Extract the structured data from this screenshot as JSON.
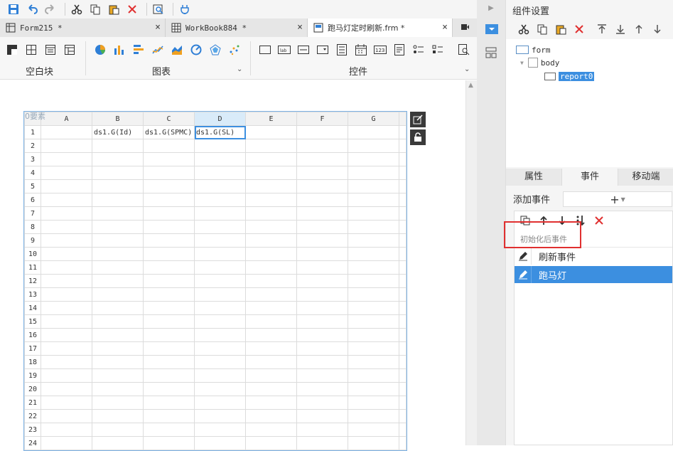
{
  "colors": {
    "accent": "#3c8fe0",
    "highlight_box": "#e03030"
  },
  "toolbar": {
    "icons": [
      "save-icon",
      "undo-icon",
      "redo-icon",
      "cut-icon",
      "copy-icon",
      "paste-icon",
      "delete-icon",
      "preview-icon",
      "plugin-icon"
    ]
  },
  "tabs": [
    {
      "label": "Form215 *",
      "icon": "form-icon"
    },
    {
      "label": "WorkBook884 *",
      "icon": "workbook-icon"
    },
    {
      "label": "跑马灯定时刷新.frm *",
      "icon": "frm-icon"
    }
  ],
  "ribbon": {
    "blank_group_label": "空白块",
    "chart_group_label": "图表",
    "widget_group_label": "控件"
  },
  "grid": {
    "corner_tag": "0要素",
    "columns": [
      "A",
      "B",
      "C",
      "D",
      "E",
      "F",
      "G"
    ],
    "rows": [
      "1",
      "2",
      "3",
      "4",
      "5",
      "6",
      "7",
      "8",
      "9",
      "10",
      "11",
      "12",
      "13",
      "14",
      "15",
      "16",
      "17",
      "18",
      "19",
      "20",
      "21",
      "22",
      "23",
      "24"
    ],
    "row1": {
      "B": "ds1.G(Id)",
      "C": "ds1.G(SPMC)",
      "D": "ds1.G(SL)"
    },
    "selected_column": "D"
  },
  "right_panel": {
    "title": "组件设置",
    "tree": {
      "form": "form",
      "body": "body",
      "report": "report0"
    },
    "tabs": [
      "属性",
      "事件",
      "移动端"
    ],
    "add_event_label": "添加事件",
    "add_event_symbol": "+",
    "hint": "初始化后事件",
    "events": [
      "刷新事件",
      "跑马灯"
    ]
  }
}
